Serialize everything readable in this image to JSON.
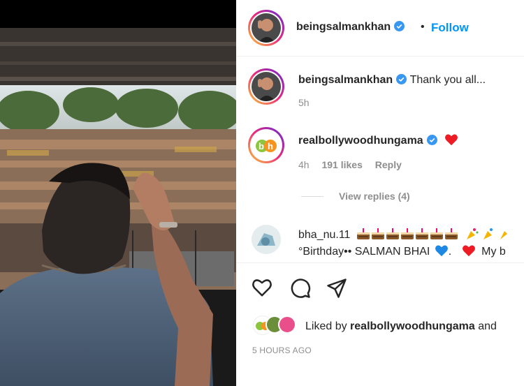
{
  "post": {
    "username": "beingsalmankhan",
    "follow_label": "Follow",
    "dot": "•"
  },
  "comments": [
    {
      "username": "beingsalmankhan",
      "text": "Thank you all...",
      "time": "5h"
    },
    {
      "username": "realbollywoodhungama",
      "time": "4h",
      "likes": "191 likes",
      "reply": "Reply",
      "view_replies": "View replies (4)"
    },
    {
      "username": "bha_nu.11",
      "line2_start": "°Birthday•• SALMAN BHAI",
      "line2_mid": ".",
      "line2_end": "My b"
    }
  ],
  "liked_by": {
    "prefix": "Liked by",
    "user": "realbollywoodhungama",
    "suffix": "and"
  },
  "timestamp": "5 HOURS AGO",
  "icons": [
    "heart-outline-icon",
    "comment-icon",
    "share-icon",
    "verified-icon",
    "red-heart-icon",
    "blue-heart-icon",
    "cake-icon",
    "party-popper-icon"
  ],
  "colors": {
    "follow": "#0095f6",
    "verified": "#3897f0",
    "heart": "#ed4956"
  }
}
